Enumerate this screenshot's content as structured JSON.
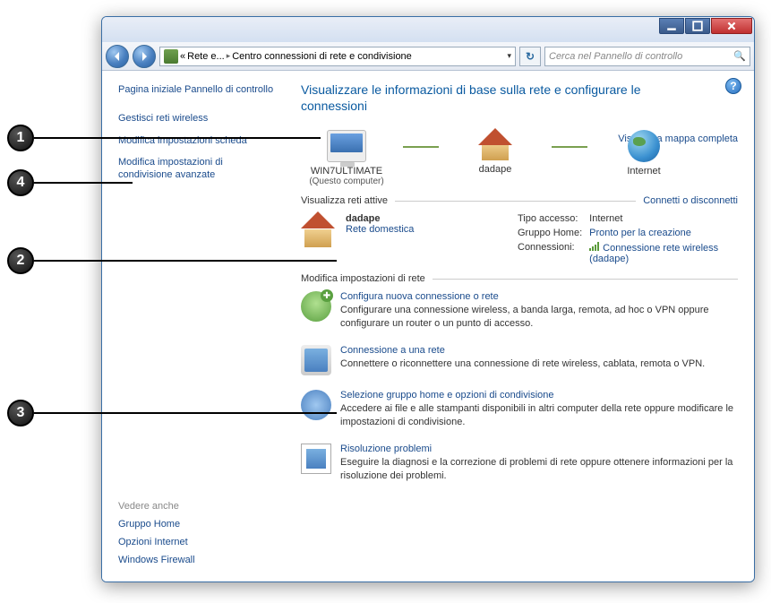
{
  "callouts": [
    "1",
    "2",
    "3",
    "4"
  ],
  "breadcrumb": {
    "lvl1_prefix": "«",
    "lvl1": "Rete e...",
    "lvl2": "Centro connessioni di rete e condivisione"
  },
  "search": {
    "placeholder": "Cerca nel Pannello di controllo"
  },
  "sidebar": {
    "home": "Pagina iniziale Pannello di controllo",
    "tasks": {
      "wireless": "Gestisci reti wireless",
      "adapter": "Modifica impostazioni scheda",
      "sharing": "Modifica impostazioni di condivisione avanzate"
    },
    "see_also_hdr": "Vedere anche",
    "see_also": {
      "homegroup": "Gruppo Home",
      "inetopt": "Opzioni Internet",
      "firewall": "Windows Firewall"
    }
  },
  "main": {
    "title": "Visualizzare le informazioni di base sulla rete e configurare le connessioni",
    "map_link": "Visualizza mappa completa",
    "nodes": {
      "pc_name": "WIN7ULTIMATE",
      "pc_sub": "(Questo computer)",
      "gw_name": "dadape",
      "net_name": "Internet"
    },
    "active_hdr": "Visualizza reti attive",
    "connect_link": "Connetti o disconnetti",
    "active": {
      "name": "dadape",
      "type": "Rete domestica",
      "access_lbl": "Tipo accesso:",
      "access_val": "Internet",
      "hg_lbl": "Gruppo Home:",
      "hg_val": "Pronto per la creazione",
      "conn_lbl": "Connessioni:",
      "conn_val": "Connessione rete wireless (dadape)"
    },
    "mod_hdr": "Modifica impostazioni di rete",
    "tasks": {
      "t1_title": "Configura nuova connessione o rete",
      "t1_desc": "Configurare una connessione wireless, a banda larga, remota, ad hoc o VPN oppure configurare un router o un punto di accesso.",
      "t2_title": "Connessione a una rete",
      "t2_desc": "Connettere o riconnettere una connessione di rete wireless, cablata, remota o VPN.",
      "t3_title": "Selezione gruppo home e opzioni di condivisione",
      "t3_desc": "Accedere ai file e alle stampanti disponibili in altri computer della rete oppure modificare le impostazioni di condivisione.",
      "t4_title": "Risoluzione problemi",
      "t4_desc": "Eseguire la diagnosi e la correzione di problemi di rete oppure ottenere informazioni per la risoluzione dei problemi."
    }
  }
}
